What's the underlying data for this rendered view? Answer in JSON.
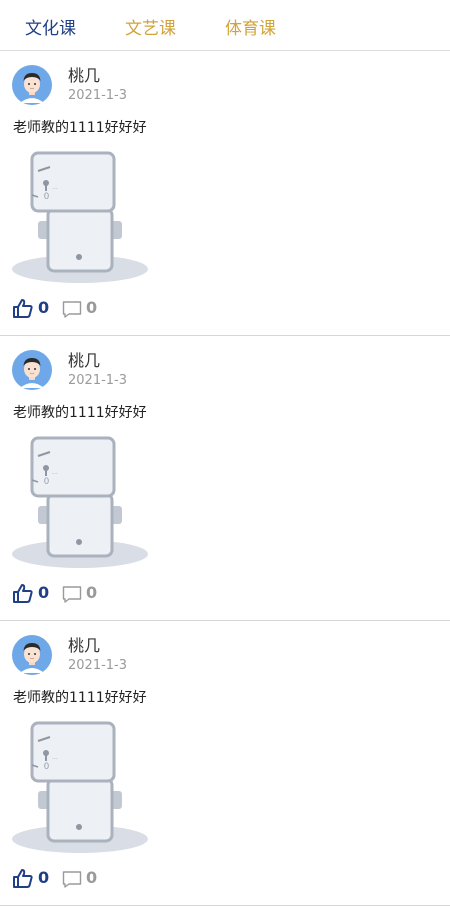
{
  "tabs": [
    {
      "label": "文化课",
      "active": true
    },
    {
      "label": "文艺课",
      "active": false
    },
    {
      "label": "体育课",
      "active": false
    }
  ],
  "colors": {
    "active_tab": "#1f3f86",
    "inactive_tab": "#d2a33a",
    "like": "#1f3f86",
    "muted": "#9a9a9a"
  },
  "posts": [
    {
      "author": "桃几",
      "date": "2021-1-3",
      "content": "老师教的1111好好好",
      "likes": "0",
      "comments": "0",
      "image_icon": "image-placeholder-icon"
    },
    {
      "author": "桃几",
      "date": "2021-1-3",
      "content": "老师教的1111好好好",
      "likes": "0",
      "comments": "0",
      "image_icon": "image-placeholder-icon"
    },
    {
      "author": "桃几",
      "date": "2021-1-3",
      "content": "老师教的1111好好好",
      "likes": "0",
      "comments": "0",
      "image_icon": "image-placeholder-icon"
    }
  ]
}
